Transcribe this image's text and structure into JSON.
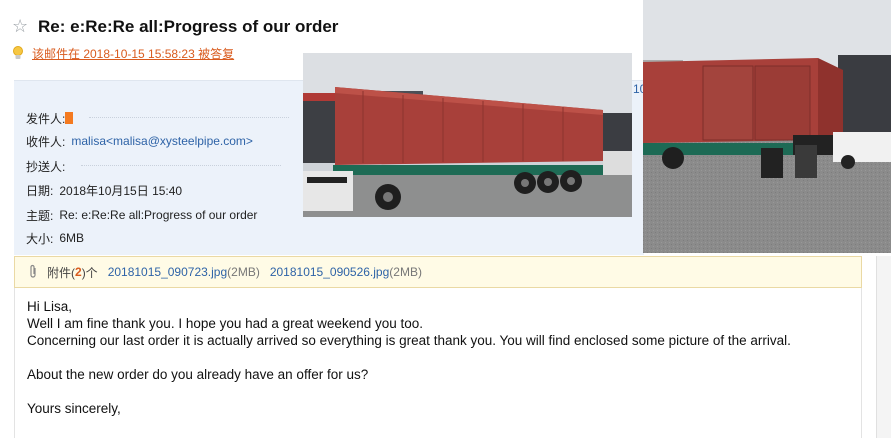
{
  "header": {
    "subject": "Re: e:Re:Re all:Progress of our order",
    "reply_note": "该邮件在 2018-10-15 15:58:23 被答复"
  },
  "info": {
    "from_label": "发件人:",
    "to_label": "收件人:",
    "to_value": "malisa<malisa@xysteelpipe.com>",
    "cc_label": "抄送人:",
    "date_label": "日期:",
    "date_value": "2018年10月15日 15:40",
    "subject_label": "主题:",
    "subject_value": "Re: e:Re:Re all:Progress of our order",
    "size_label": "大小:",
    "size_value": "6MB",
    "side_digit": "10"
  },
  "attachments": {
    "label_prefix": "附件(",
    "count": "2",
    "label_suffix": ")个",
    "files": [
      {
        "name": "20181015_090723.jpg",
        "size": "(2MB)"
      },
      {
        "name": "20181015_090526.jpg",
        "size": "(2MB)"
      }
    ]
  },
  "body": {
    "lines": [
      "Hi Lisa,",
      "Well I am fine thank you. I hope you had a great weekend you too.",
      "Concerning our last order it is actually arrived so everything is great thank you. You will find enclosed some picture of the arrival.",
      "",
      "About the new order do you already have an offer for us?",
      "",
      "Yours sincerely,"
    ]
  },
  "colors": {
    "link": "#2e63a7",
    "reply_note": "#d95b1e",
    "info_panel_bg": "#ecf2fa",
    "attach_bg": "#fffbe6",
    "container_red": "#a8403a"
  }
}
